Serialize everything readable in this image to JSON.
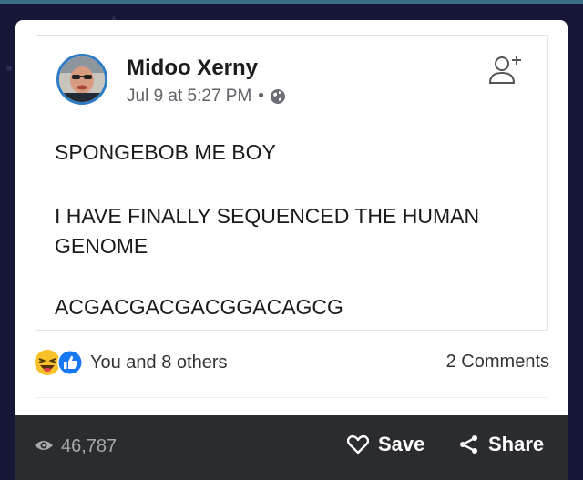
{
  "post": {
    "author": "Midoo Xerny",
    "timestamp": "Jul 9 at 5:27 PM",
    "separator": "•",
    "lines": [
      "SPONGEBOB ME BOY",
      "I HAVE FINALLY SEQUENCED THE HUMAN",
      "GENOME",
      "ACGACGACGACGGACAGCG"
    ]
  },
  "reactions": {
    "icons": [
      "laughing-emoji-icon",
      "like-thumb-icon"
    ],
    "likes_text": "You and 8 others",
    "comments_text": "2 Comments"
  },
  "actions": {
    "views_icon": "eye-icon",
    "views": "46,787",
    "save_label": "Save",
    "save_icon": "heart-outline-icon",
    "share_label": "Share",
    "share_icon": "share-icon"
  },
  "colors": {
    "background": "#161736",
    "card": "#ffffff",
    "bottom_bar": "#2b2c30",
    "avatar_ring": "#2e7cc4",
    "like_blue": "#1877f2"
  }
}
